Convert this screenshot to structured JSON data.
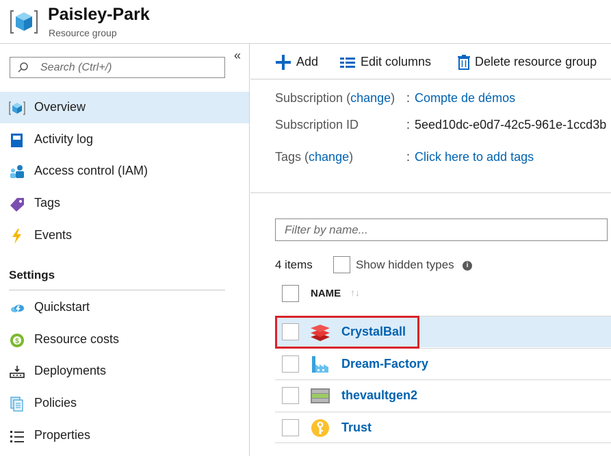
{
  "header": {
    "title": "Paisley-Park",
    "subtitle": "Resource group"
  },
  "sidebar": {
    "search_placeholder": "Search (Ctrl+/)",
    "collapse_glyph": "«",
    "items": [
      {
        "label": "Overview",
        "icon": "cube-icon",
        "active": true
      },
      {
        "label": "Activity log",
        "icon": "log-book-icon"
      },
      {
        "label": "Access control (IAM)",
        "icon": "users-icon"
      },
      {
        "label": "Tags",
        "icon": "tag-icon"
      },
      {
        "label": "Events",
        "icon": "lightning-icon"
      }
    ],
    "section_title": "Settings",
    "settings_items": [
      {
        "label": "Quickstart",
        "icon": "cloud-icon"
      },
      {
        "label": "Resource costs",
        "icon": "cost-icon"
      },
      {
        "label": "Deployments",
        "icon": "deployments-icon"
      },
      {
        "label": "Policies",
        "icon": "policies-icon"
      },
      {
        "label": "Properties",
        "icon": "properties-icon"
      }
    ]
  },
  "toolbar": {
    "add_label": "Add",
    "edit_columns_label": "Edit columns",
    "delete_label": "Delete resource group"
  },
  "essentials": {
    "subscription_key": "Subscription",
    "subscription_open": " (",
    "change_label": "change",
    "subscription_close": ")",
    "subscription_value": "Compte de démos",
    "subscription_id_key": "Subscription ID",
    "subscription_id_value": "5eed10dc-e0d7-42c5-961e-1ccd3b",
    "tags_key": "Tags",
    "tags_open": " (",
    "tags_change_label": "change",
    "tags_close": ")",
    "tags_value": "Click here to add tags",
    "colon": ":"
  },
  "resources": {
    "filter_placeholder": "Filter by name...",
    "count": "4 items",
    "show_hidden_label": "Show hidden types",
    "info_glyph": "i",
    "column_name": "NAME",
    "sort_glyph": "↑↓",
    "rows": [
      {
        "name": "CrystalBall",
        "icon": "stack-layers-icon",
        "selected": true
      },
      {
        "name": "Dream-Factory",
        "icon": "factory-icon"
      },
      {
        "name": "thevaultgen2",
        "icon": "storage-icon"
      },
      {
        "name": "Trust",
        "icon": "key-vault-icon"
      }
    ]
  },
  "colors": {
    "link": "#0063b1",
    "selected_bg": "#dcecf8",
    "highlight": "#d9232a"
  }
}
